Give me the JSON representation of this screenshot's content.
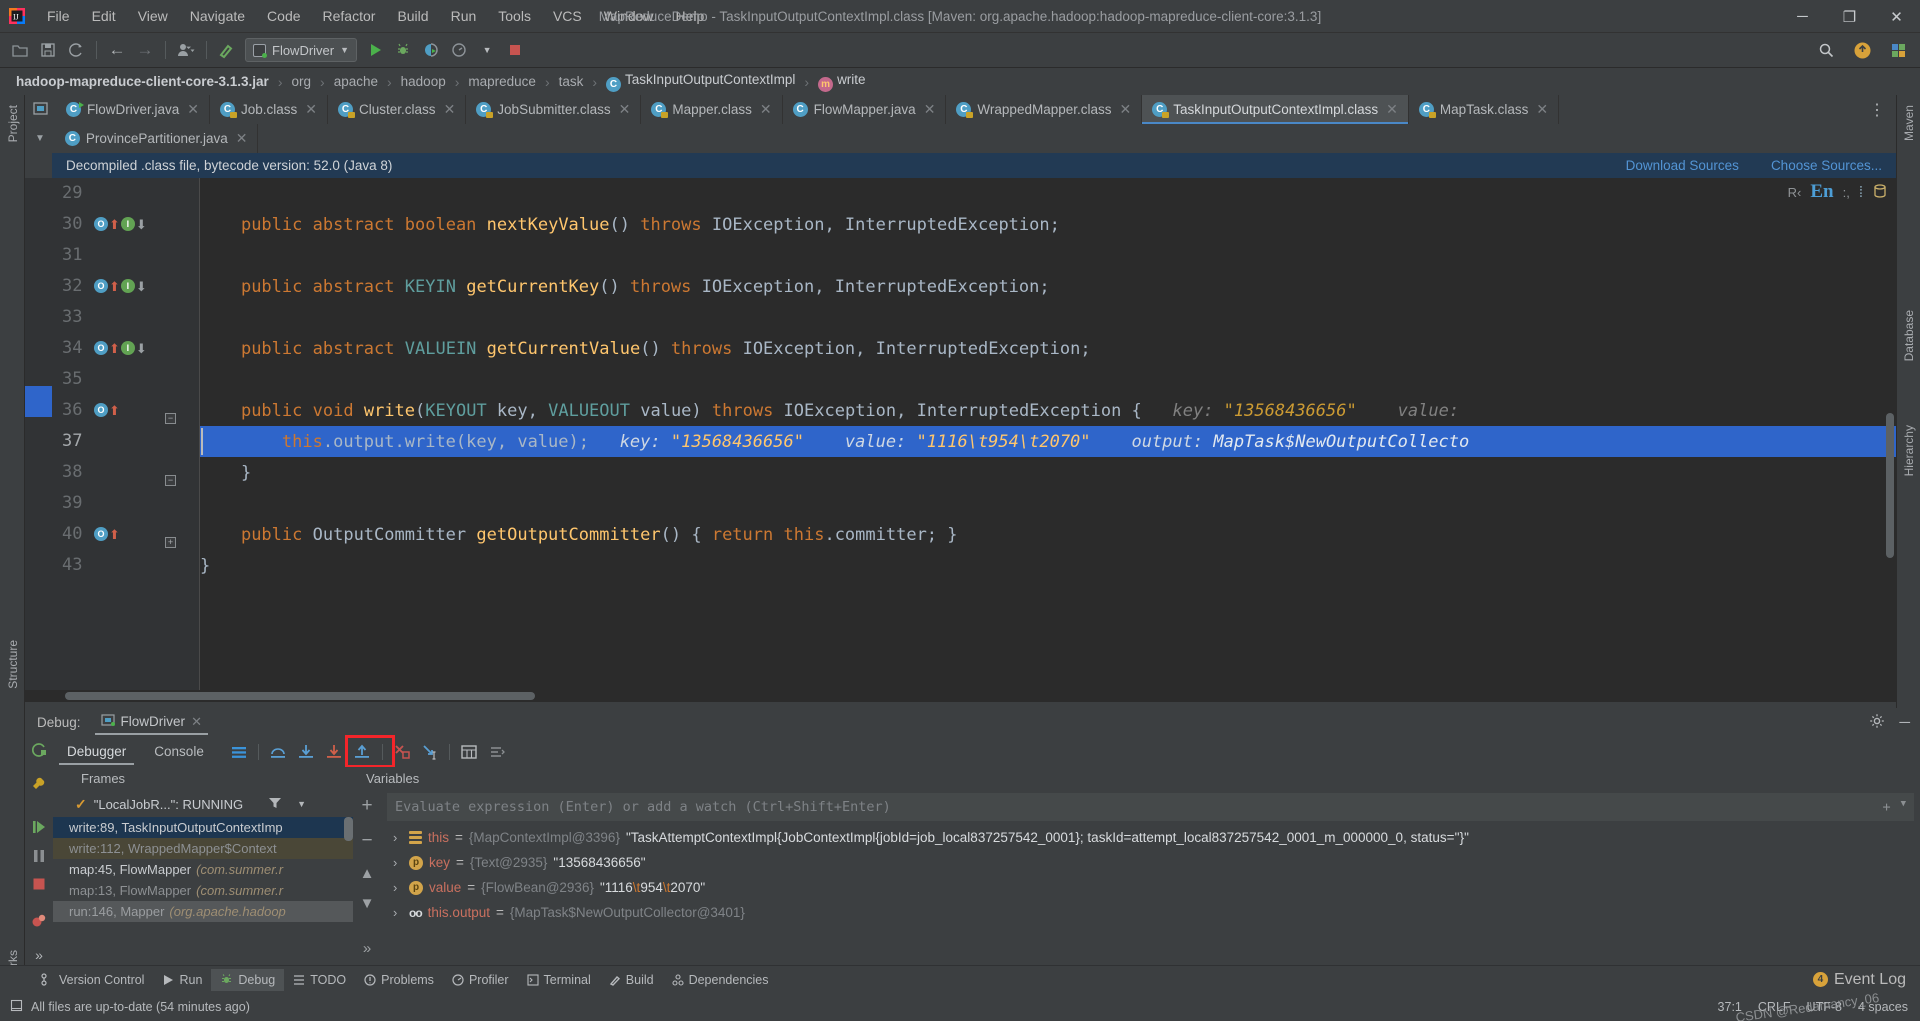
{
  "window": {
    "title": "MapReduceDemo - TaskInputOutputContextImpl.class [Maven: org.apache.hadoop:hadoop-mapreduce-client-core:3.1.3]",
    "minimize": "─",
    "maximize": "❐",
    "close": "✕"
  },
  "menu": [
    "File",
    "Edit",
    "View",
    "Navigate",
    "Code",
    "Refactor",
    "Build",
    "Run",
    "Tools",
    "VCS",
    "Window",
    "Help"
  ],
  "toolbar": {
    "run_config": "FlowDriver",
    "icons": {
      "open": "open-folder-icon",
      "save": "save-icon",
      "sync": "sync-icon",
      "back": "←",
      "forward": "→",
      "profile": "user-icon",
      "build": "build-hammer-icon",
      "run": "run-icon",
      "debug": "debug-icon",
      "coverage": "coverage-icon",
      "profiler": "profiler-icon",
      "stop": "stop-icon",
      "search": "search-icon",
      "updates": "update-badge-icon",
      "plugin": "plugin-icon"
    }
  },
  "breadcrumb": {
    "jar": "hadoop-mapreduce-client-core-3.1.3.jar",
    "items": [
      "org",
      "apache",
      "hadoop",
      "mapreduce",
      "task"
    ],
    "class": "TaskInputOutputContextImpl",
    "method": "write",
    "separator": "›"
  },
  "editor_tabs_row1": [
    {
      "label": "FlowDriver.java",
      "icon": "java-runnable-icon",
      "active": false
    },
    {
      "label": "Job.class",
      "icon": "class-file-icon",
      "active": false
    },
    {
      "label": "Cluster.class",
      "icon": "class-file-icon",
      "active": false
    },
    {
      "label": "JobSubmitter.class",
      "icon": "class-file-icon",
      "active": false
    },
    {
      "label": "Mapper.class",
      "icon": "class-file-icon",
      "active": false
    },
    {
      "label": "FlowMapper.java",
      "icon": "java-file-icon",
      "active": false
    },
    {
      "label": "WrappedMapper.class",
      "icon": "class-file-icon",
      "active": false
    },
    {
      "label": "TaskInputOutputContextImpl.class",
      "icon": "class-file-icon",
      "active": true
    },
    {
      "label": "MapTask.class",
      "icon": "class-file-icon",
      "active": false
    }
  ],
  "editor_tabs_row2": [
    {
      "label": "ProvincePartitioner.java",
      "icon": "java-file-icon",
      "active": false
    }
  ],
  "banner": {
    "message": "Decompiled .class file, bytecode version: 52.0 (Java 8)",
    "download_sources": "Download Sources",
    "choose_sources": "Choose Sources..."
  },
  "editor": {
    "inspections_prefix": "R‹",
    "inspections_lang": "En",
    "inspections_suffix": ":,",
    "lines": [
      {
        "num": "29",
        "segments": []
      },
      {
        "num": "30",
        "markers": [
          "override",
          "implement"
        ],
        "segments": [
          {
            "t": "    ",
            "c": ""
          },
          {
            "t": "public",
            "c": "kw"
          },
          {
            "t": " ",
            "c": ""
          },
          {
            "t": "abstract",
            "c": "kw"
          },
          {
            "t": " ",
            "c": ""
          },
          {
            "t": "boolean",
            "c": "kw"
          },
          {
            "t": " ",
            "c": ""
          },
          {
            "t": "nextKeyValue",
            "c": "mth"
          },
          {
            "t": "() ",
            "c": ""
          },
          {
            "t": "throws",
            "c": "kw"
          },
          {
            "t": " IOException, InterruptedException;",
            "c": ""
          }
        ]
      },
      {
        "num": "31",
        "segments": []
      },
      {
        "num": "32",
        "markers": [
          "override",
          "implement"
        ],
        "segments": [
          {
            "t": "    ",
            "c": ""
          },
          {
            "t": "public",
            "c": "kw"
          },
          {
            "t": " ",
            "c": ""
          },
          {
            "t": "abstract",
            "c": "kw"
          },
          {
            "t": " ",
            "c": ""
          },
          {
            "t": "KEYIN",
            "c": "typ"
          },
          {
            "t": " ",
            "c": ""
          },
          {
            "t": "getCurrentKey",
            "c": "mth"
          },
          {
            "t": "() ",
            "c": ""
          },
          {
            "t": "throws",
            "c": "kw"
          },
          {
            "t": " IOException, InterruptedException;",
            "c": ""
          }
        ]
      },
      {
        "num": "33",
        "segments": []
      },
      {
        "num": "34",
        "markers": [
          "override",
          "implement"
        ],
        "segments": [
          {
            "t": "    ",
            "c": ""
          },
          {
            "t": "public",
            "c": "kw"
          },
          {
            "t": " ",
            "c": ""
          },
          {
            "t": "abstract",
            "c": "kw"
          },
          {
            "t": " ",
            "c": ""
          },
          {
            "t": "VALUEIN",
            "c": "typ"
          },
          {
            "t": " ",
            "c": ""
          },
          {
            "t": "getCurrentValue",
            "c": "mth"
          },
          {
            "t": "() ",
            "c": ""
          },
          {
            "t": "throws",
            "c": "kw"
          },
          {
            "t": " IOException, InterruptedException;",
            "c": ""
          }
        ]
      },
      {
        "num": "35",
        "segments": []
      },
      {
        "num": "36",
        "markers": [
          "override"
        ],
        "fold": "−",
        "segments": [
          {
            "t": "    ",
            "c": ""
          },
          {
            "t": "public",
            "c": "kw"
          },
          {
            "t": " ",
            "c": ""
          },
          {
            "t": "void",
            "c": "kw"
          },
          {
            "t": " ",
            "c": ""
          },
          {
            "t": "write",
            "c": "mth"
          },
          {
            "t": "(",
            "c": ""
          },
          {
            "t": "KEYOUT",
            "c": "typ"
          },
          {
            "t": " key, ",
            "c": ""
          },
          {
            "t": "VALUEOUT",
            "c": "typ"
          },
          {
            "t": " value) ",
            "c": ""
          },
          {
            "t": "throws",
            "c": "kw"
          },
          {
            "t": " IOException, InterruptedException {",
            "c": ""
          },
          {
            "t": "   key: ",
            "c": "hint"
          },
          {
            "t": "\"13568436656\"",
            "c": "hintv"
          },
          {
            "t": "    value:",
            "c": "hint"
          }
        ]
      },
      {
        "num": "37",
        "current": true,
        "highlight": true,
        "segments": [
          {
            "t": "        ",
            "c": ""
          },
          {
            "t": "this",
            "c": "kw"
          },
          {
            "t": ".output.",
            "c": ""
          },
          {
            "t": "write",
            "c": ""
          },
          {
            "t": "(key, value);",
            "c": ""
          },
          {
            "t": "   key: ",
            "c": "hint"
          },
          {
            "t": "\"13568436656\"",
            "c": "hintv"
          },
          {
            "t": "    value: ",
            "c": "hint"
          },
          {
            "t": "\"1116\\t954\\t2070\"",
            "c": "hintv"
          },
          {
            "t": "    output: ",
            "c": "hint"
          },
          {
            "t": "MapTask$NewOutputCollecto",
            "c": "hintc"
          }
        ]
      },
      {
        "num": "38",
        "fold": "−",
        "segments": [
          {
            "t": "    }",
            "c": ""
          }
        ]
      },
      {
        "num": "39",
        "segments": []
      },
      {
        "num": "40",
        "markers": [
          "override"
        ],
        "fold": "+",
        "segments": [
          {
            "t": "    ",
            "c": ""
          },
          {
            "t": "public",
            "c": "kw"
          },
          {
            "t": " ",
            "c": ""
          },
          {
            "t": "OutputCommitter",
            "c": ""
          },
          {
            "t": " ",
            "c": ""
          },
          {
            "t": "getOutputCommitter",
            "c": "mth"
          },
          {
            "t": "() { ",
            "c": ""
          },
          {
            "t": "return",
            "c": "kw"
          },
          {
            "t": " ",
            "c": ""
          },
          {
            "t": "this",
            "c": "kw"
          },
          {
            "t": ".committer; }",
            "c": ""
          }
        ]
      },
      {
        "num": "43",
        "segments": [
          {
            "t": "}",
            "c": ""
          }
        ]
      }
    ]
  },
  "debug": {
    "label": "Debug:",
    "session_tab": "FlowDriver",
    "tabs": [
      {
        "label": "Debugger",
        "active": true
      },
      {
        "label": "Console",
        "active": false
      }
    ],
    "toolbar_icons": [
      "show-execution-point-icon",
      "step-over-icon",
      "step-into-icon",
      "force-step-into-icon",
      "step-out-icon",
      "drop-frame-icon",
      "run-to-cursor-icon",
      "evaluate-expression-icon",
      "layout-settings-icon"
    ],
    "highlighted_icon": "step-out-icon",
    "rail_icons": [
      "rerun-icon",
      "settings-wrench-icon",
      "resume-icon",
      "pause-icon",
      "stop-icon",
      "mute-breakpoints-icon",
      "more-icon"
    ],
    "frames_header": "Frames",
    "variables_header": "Variables",
    "thread": "\"LocalJobR...\": RUNNING",
    "frames": [
      {
        "label": "write:89, TaskInputOutputContextImp",
        "suffix": "",
        "style": "sel"
      },
      {
        "label": "write:112, WrappedMapper$Context",
        "suffix": "",
        "style": "dim"
      },
      {
        "label": "map:45, FlowMapper",
        "suffix": "(com.summer.r",
        "style": "normal"
      },
      {
        "label": "map:13, FlowMapper",
        "suffix": "(com.summer.r",
        "style": "dim2"
      },
      {
        "label": "run:146, Mapper",
        "suffix": "(org.apache.hadoop",
        "style": "gray"
      }
    ],
    "evaluate_placeholder": "Evaluate expression (Enter) or add a watch (Ctrl+Shift+Enter)",
    "variables": [
      {
        "icon": "field-icon",
        "name": "this",
        "ref": "{MapContextImpl@3396}",
        "value": "\"TaskAttemptContextImpl{JobContextImpl{jobId=job_local837257542_0001}; taskId=attempt_local837257542_0001_m_000000_0, status=''}\""
      },
      {
        "icon": "parameter-icon",
        "name": "key",
        "ref": "{Text@2935}",
        "value": "\"13568436656\""
      },
      {
        "icon": "parameter-icon",
        "name": "value",
        "ref": "{FlowBean@2936}",
        "value": "\"1116\\t954\\t2070\""
      },
      {
        "icon": "watch-icon",
        "name": "this.output",
        "ref": "{MapTask$NewOutputCollector@3401}",
        "value": ""
      }
    ]
  },
  "left_strips": [
    "Project",
    "Structure",
    "Bookmarks"
  ],
  "right_strips": [
    "Maven",
    "Database",
    "Hierarchy"
  ],
  "toolwindow_bar": [
    {
      "label": "Version Control",
      "icon": "branch-icon",
      "active": false
    },
    {
      "label": "Run",
      "icon": "run-icon",
      "active": false
    },
    {
      "label": "Debug",
      "icon": "debug-icon",
      "active": true
    },
    {
      "label": "TODO",
      "icon": "todo-icon",
      "active": false
    },
    {
      "label": "Problems",
      "icon": "problems-icon",
      "active": false
    },
    {
      "label": "Profiler",
      "icon": "profiler-icon",
      "active": false
    },
    {
      "label": "Terminal",
      "icon": "terminal-icon",
      "active": false
    },
    {
      "label": "Build",
      "icon": "build-icon",
      "active": false
    },
    {
      "label": "Dependencies",
      "icon": "dependencies-icon",
      "active": false
    }
  ],
  "event_log": {
    "label": "Event Log",
    "count": "4"
  },
  "statusbar": {
    "message": "All files are up-to-date (54 minutes ago)",
    "position": "37:1",
    "line_sep": "CRLF",
    "encoding": "UTF-8",
    "indent": "4 spaces"
  },
  "watermark": "CSDN @Redamancy_06",
  "colors": {
    "accent": "#4a88c7",
    "selection": "#2f65ca",
    "banner": "#223a54",
    "keyword": "#cc7832",
    "method": "#ffc66d",
    "type": "#5f9e9e",
    "red_highlight": "#f4252a"
  }
}
